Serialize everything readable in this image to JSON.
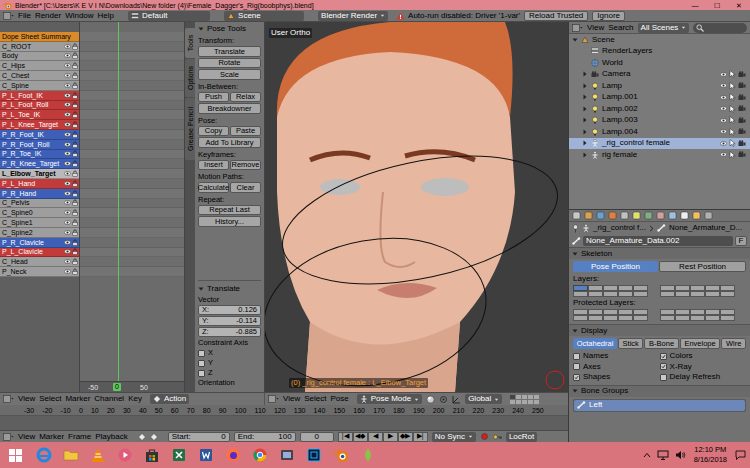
{
  "window": {
    "title": "Blender* [C:\\Users\\K E V I N\\Downloads\\New folder (4)\\Female_Dagger's_Rig(boobphys).blend]",
    "controls": [
      "—",
      "☐",
      "✕"
    ]
  },
  "info_header": {
    "menus": [
      "File",
      "Render",
      "Window",
      "Help"
    ],
    "layout": "Default",
    "scene": "Scene",
    "engine": "Blender Render",
    "warning": "Auto-run disabled: Driver '1-var'",
    "buttons": [
      "Reload Trusted",
      "Ignore"
    ]
  },
  "dopesheet": {
    "channels": [
      {
        "name": "Dope Sheet Summary",
        "kind": "summary",
        "color": "#d98b2b",
        "selected": false
      },
      {
        "name": "C_ROOT",
        "kind": "group",
        "color": "#9e9e9e",
        "selected": false
      },
      {
        "name": "Body",
        "kind": "group",
        "color": "#9e9e9e",
        "selected": false
      },
      {
        "name": "C_Hips",
        "kind": "group",
        "color": "#9e9e9e",
        "selected": false
      },
      {
        "name": "C_Chest",
        "kind": "group",
        "color": "#9e9e9e",
        "selected": false
      },
      {
        "name": "C_Spine",
        "kind": "group",
        "color": "#9e9e9e",
        "selected": false
      },
      {
        "name": "P_L_Foot_IK",
        "kind": "group",
        "color": "#c23b3b",
        "selected": false
      },
      {
        "name": "P_L_Foot_Roll",
        "kind": "group",
        "color": "#c23b3b",
        "selected": false
      },
      {
        "name": "P_L_Toe_IK",
        "kind": "group",
        "color": "#c23b3b",
        "selected": false
      },
      {
        "name": "P_L_Knee_Target",
        "kind": "group",
        "color": "#c23b3b",
        "selected": false
      },
      {
        "name": "P_R_Foot_IK",
        "kind": "group",
        "color": "#3d5fb8",
        "selected": false
      },
      {
        "name": "P_R_Foot_Roll",
        "kind": "group",
        "color": "#3d5fb8",
        "selected": false
      },
      {
        "name": "P_R_Toe_IK",
        "kind": "group",
        "color": "#3d5fb8",
        "selected": false
      },
      {
        "name": "P_R_Knee_Target",
        "kind": "group",
        "color": "#3d5fb8",
        "selected": false
      },
      {
        "name": "L_Elbow_Target",
        "kind": "group",
        "color": "#b9b9b9",
        "selected": true
      },
      {
        "name": "P_L_Hand",
        "kind": "group",
        "color": "#c23b3b",
        "selected": false
      },
      {
        "name": "P_R_Hand",
        "kind": "group",
        "color": "#3d5fb8",
        "selected": false
      },
      {
        "name": "C_Pelvis",
        "kind": "group",
        "color": "#9e9e9e",
        "selected": false
      },
      {
        "name": "C_Spine0",
        "kind": "group",
        "color": "#9e9e9e",
        "selected": false
      },
      {
        "name": "C_Spine1",
        "kind": "group",
        "color": "#9e9e9e",
        "selected": false
      },
      {
        "name": "C_Spine2",
        "kind": "group",
        "color": "#9e9e9e",
        "selected": false
      },
      {
        "name": "P_R_Clavicle",
        "kind": "group",
        "color": "#3d5fb8",
        "selected": false
      },
      {
        "name": "P_L_Clavicle",
        "kind": "group",
        "color": "#c23b3b",
        "selected": false
      },
      {
        "name": "C_Head",
        "kind": "group",
        "color": "#9e9e9e",
        "selected": false
      },
      {
        "name": "P_Neck",
        "kind": "group",
        "color": "#9e9e9e",
        "selected": false
      }
    ],
    "ruler": [
      "-50",
      "50"
    ],
    "current_frame": "0"
  },
  "dopesheet_header": {
    "menus": [
      "View",
      "Select",
      "Marker",
      "Channel",
      "Key"
    ],
    "mode": "Action"
  },
  "tool_shelf": {
    "tabs": [
      {
        "label": "Tools",
        "selected": true
      },
      {
        "label": "Options",
        "selected": false
      },
      {
        "label": "Grease Pencil",
        "selected": false
      }
    ],
    "title": "Pose Tools",
    "sections": [
      {
        "label": "Transform:",
        "rows": [
          [
            "Translate"
          ],
          [
            "Rotate"
          ],
          [
            "Scale"
          ]
        ]
      },
      {
        "label": "In-Between:",
        "rows": [
          [
            "Push",
            "Relax"
          ],
          [
            "Breakdowner"
          ]
        ]
      },
      {
        "label": "Pose:",
        "rows": [
          [
            "Copy",
            "Paste"
          ],
          [
            "Add To Library"
          ]
        ]
      },
      {
        "label": "Keyframes:",
        "rows": [
          [
            "Insert",
            "Remove"
          ]
        ]
      },
      {
        "label": "Motion Paths:",
        "rows": [
          [
            "Calculate",
            "Clear"
          ]
        ]
      },
      {
        "label": "Repeat:",
        "rows": [
          [
            "Repeat Last"
          ],
          [
            "History..."
          ]
        ]
      }
    ]
  },
  "operator": {
    "title": "Translate",
    "vector_label": "Vector",
    "fields": [
      {
        "label": "X:",
        "value": "0.126"
      },
      {
        "label": "Y:",
        "value": "-0.114"
      },
      {
        "label": "Z:",
        "value": "-0.885"
      }
    ],
    "constraint_label": "Constraint Axis",
    "axes": [
      {
        "label": "X",
        "checked": false
      },
      {
        "label": "Y",
        "checked": false
      },
      {
        "label": "Z",
        "checked": false
      }
    ],
    "orientation_label": "Orientation"
  },
  "viewport": {
    "view_name": "User Ortho",
    "status": "(0) _rig_control female : L_Elbow_Target"
  },
  "view3d_header": {
    "menus": [
      "View",
      "Select",
      "Pose"
    ],
    "mode": "Pose Mode",
    "orientation": "Global"
  },
  "timeline": {
    "ruler": [
      "-30",
      "-20",
      "-10",
      "0",
      "10",
      "20",
      "30",
      "40",
      "50",
      "60",
      "70",
      "80",
      "90",
      "100",
      "110",
      "120",
      "130",
      "140",
      "150",
      "160",
      "170",
      "180",
      "190",
      "200",
      "210",
      "220",
      "230",
      "240",
      "250"
    ],
    "menus": [
      "View",
      "Marker",
      "Frame",
      "Playback"
    ],
    "start_label": "Start:",
    "start": "0",
    "end_label": "End:",
    "end": "100",
    "frame": "0",
    "transport": [
      "|◀",
      "◀◆",
      "◀",
      "▶",
      "◆▶",
      "▶|"
    ],
    "sync": "No Sync",
    "keying_set": "LocRot"
  },
  "outliner": {
    "menus": [
      "View",
      "Search"
    ],
    "filter": "All Scenes",
    "items": [
      {
        "name": "Scene",
        "kind": "scene",
        "depth": 0,
        "expandable": true,
        "expanded": true,
        "selected": false
      },
      {
        "name": "RenderLayers",
        "kind": "layers",
        "depth": 1,
        "expandable": false,
        "expanded": false,
        "selected": false
      },
      {
        "name": "World",
        "kind": "world",
        "depth": 1,
        "expandable": false,
        "expanded": false,
        "selected": false
      },
      {
        "name": "Camera",
        "kind": "camera",
        "depth": 1,
        "expandable": true,
        "expanded": false,
        "selected": false
      },
      {
        "name": "Lamp",
        "kind": "lamp",
        "depth": 1,
        "expandable": true,
        "expanded": false,
        "selected": false
      },
      {
        "name": "Lamp.001",
        "kind": "lamp",
        "depth": 1,
        "expandable": true,
        "expanded": false,
        "selected": false
      },
      {
        "name": "Lamp.002",
        "kind": "lamp",
        "depth": 1,
        "expandable": true,
        "expanded": false,
        "selected": false
      },
      {
        "name": "Lamp.003",
        "kind": "lamp",
        "depth": 1,
        "expandable": true,
        "expanded": false,
        "selected": false
      },
      {
        "name": "Lamp.004",
        "kind": "lamp",
        "depth": 1,
        "expandable": true,
        "expanded": false,
        "selected": false
      },
      {
        "name": "_rig_control female",
        "kind": "armature",
        "depth": 1,
        "expandable": true,
        "expanded": false,
        "selected": true
      },
      {
        "name": "rig female",
        "kind": "armature",
        "depth": 1,
        "expandable": true,
        "expanded": false,
        "selected": false
      }
    ]
  },
  "properties": {
    "path": [
      "_rig_control f...",
      "None_Armature_D..."
    ],
    "data_name": "None_Armature_Data.002",
    "fake_user": "F",
    "skeleton": {
      "title": "Skeleton",
      "positions": [
        {
          "label": "Pose Position",
          "selected": true
        },
        {
          "label": "Rest Position",
          "selected": false
        }
      ],
      "layers_label": "Layers:",
      "layers": [
        true,
        false,
        false,
        false,
        false,
        false,
        false,
        false,
        false,
        false,
        false,
        false,
        false,
        false,
        false,
        false,
        false,
        false,
        false,
        false
      ],
      "protected_label": "Protected Layers:",
      "protected": [
        false,
        false,
        false,
        false,
        false,
        false,
        false,
        false,
        false,
        false,
        false,
        false,
        false,
        false,
        false,
        false,
        false,
        false,
        false,
        false
      ]
    },
    "display": {
      "title": "Display",
      "draw_types": [
        {
          "label": "Octahedral",
          "selected": true
        },
        {
          "label": "Stick",
          "selected": false
        },
        {
          "label": "B-Bone",
          "selected": false
        },
        {
          "label": "Envelope",
          "selected": false
        },
        {
          "label": "Wire",
          "selected": false
        }
      ],
      "options": [
        {
          "label": "Names",
          "checked": false
        },
        {
          "label": "Colors",
          "checked": true
        },
        {
          "label": "Axes",
          "checked": false
        },
        {
          "label": "X-Ray",
          "checked": true
        },
        {
          "label": "Shapes",
          "checked": true
        },
        {
          "label": "Delay Refresh",
          "checked": false
        }
      ]
    },
    "bone_groups": {
      "title": "Bone Groups",
      "items": [
        {
          "name": "Left",
          "selected": true
        }
      ]
    }
  },
  "taskbar": {
    "time": "12:10 PM",
    "date": "8/16/2018"
  }
}
